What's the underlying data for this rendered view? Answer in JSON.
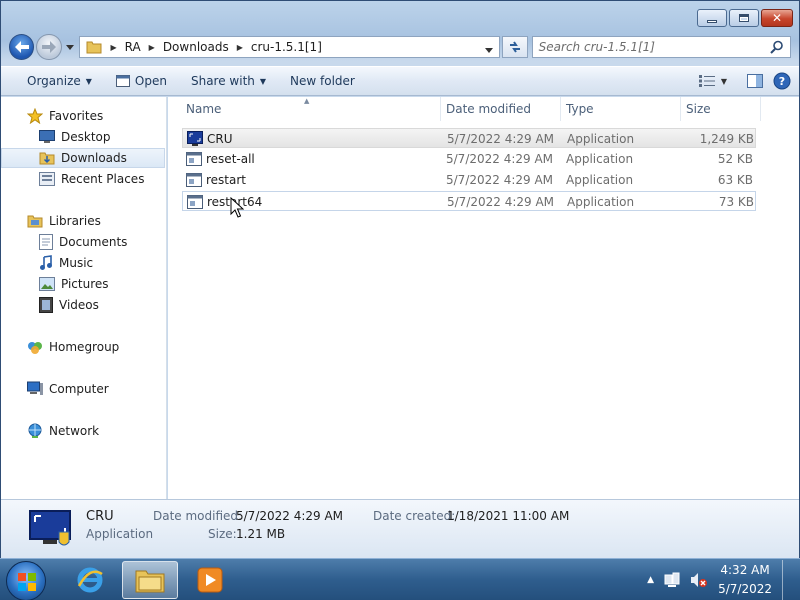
{
  "window": {
    "caption": {
      "minimize": "minimize",
      "maximize": "maximize",
      "close": "close"
    }
  },
  "address": {
    "breadcrumbs": [
      "RA",
      "Downloads",
      "cru-1.5.1[1]"
    ],
    "search_placeholder": "Search cru-1.5.1[1]"
  },
  "toolbar": {
    "organize": "Organize",
    "open": "Open",
    "share_with": "Share with",
    "new_folder": "New folder"
  },
  "navpane": {
    "favorites": "Favorites",
    "desktop": "Desktop",
    "downloads": "Downloads",
    "recent_places": "Recent Places",
    "libraries": "Libraries",
    "documents": "Documents",
    "music": "Music",
    "pictures": "Pictures",
    "videos": "Videos",
    "homegroup": "Homegroup",
    "computer": "Computer",
    "network": "Network"
  },
  "columns": {
    "name": "Name",
    "date_modified": "Date modified",
    "type": "Type",
    "size": "Size"
  },
  "files": [
    {
      "name": "CRU",
      "date": "5/7/2022 4:29 AM",
      "type": "Application",
      "size": "1,249 KB"
    },
    {
      "name": "reset-all",
      "date": "5/7/2022 4:29 AM",
      "type": "Application",
      "size": "52 KB"
    },
    {
      "name": "restart",
      "date": "5/7/2022 4:29 AM",
      "type": "Application",
      "size": "63 KB"
    },
    {
      "name": "restart64",
      "date": "5/7/2022 4:29 AM",
      "type": "Application",
      "size": "73 KB"
    }
  ],
  "details": {
    "name": "CRU",
    "type": "Application",
    "date_modified_label": "Date modified:",
    "date_modified": "5/7/2022 4:29 AM",
    "size_label": "Size:",
    "size": "1.21 MB",
    "date_created_label": "Date created:",
    "date_created": "1/18/2021 11:00 AM"
  },
  "taskbar": {
    "time": "4:32 AM",
    "date": "5/7/2022"
  },
  "colors": {
    "accent": "#1e56b0",
    "title_bar": "#bcd3ea",
    "close_button": "#c7452c"
  }
}
